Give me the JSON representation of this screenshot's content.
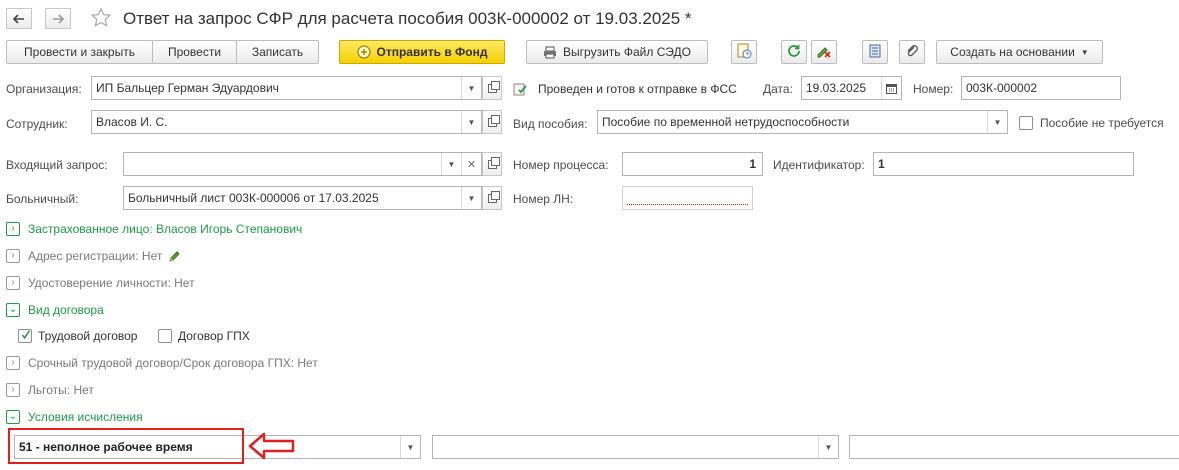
{
  "window": {
    "title": "Ответ на запрос СФР для расчета пособия 003К-000002 от 19.03.2025 *",
    "back_icon": "arrow-left-icon",
    "forward_icon": "arrow-right-icon",
    "favorite_icon": "star-icon"
  },
  "toolbar": {
    "post_close": "Провести и закрыть",
    "post": "Провести",
    "save": "Записать",
    "send_fund": "Отправить в Фонд",
    "export_sedo": "Выгрузить Файл СЭДО",
    "create_based": "Создать на основании"
  },
  "form": {
    "org_label": "Организация:",
    "org_value": "ИП Бальцер Герман Эдуардович",
    "status_text": "Проведен и готов к отправке в ФСС",
    "date_label": "Дата:",
    "date_value": "19.03.2025",
    "number_label": "Номер:",
    "number_value": "003К-000002",
    "employee_label": "Сотрудник:",
    "employee_value": "Власов И. С.",
    "benefit_type_label": "Вид пособия:",
    "benefit_type_value": "Пособие по временной нетрудоспособности",
    "benefit_not_required_label": "Пособие не требуется",
    "incoming_request_label": "Входящий запрос:",
    "incoming_request_value": "",
    "process_number_label": "Номер процесса:",
    "process_number_value": "1",
    "identifier_label": "Идентификатор:",
    "identifier_value": "1",
    "sick_leave_label": "Больничный:",
    "sick_leave_value": "Больничный лист 003К-000006 от 17.03.2025",
    "ln_number_label": "Номер ЛН:",
    "ln_number_value": ""
  },
  "sections": {
    "insured": "Застрахованное лицо: Власов Игорь Степанович",
    "address": "Адрес регистрации: Нет",
    "id_doc": "Удостоверение личности: Нет",
    "contract_type": "Вид договора",
    "labor_contract": "Трудовой договор",
    "gph_contract": "Договор ГПХ",
    "fixed_term": "Срочный трудовой договор/Срок договора ГПХ: Нет",
    "benefits": "Льготы: Нет",
    "calc_conditions": "Условия исчисления"
  },
  "conditions": {
    "condition1_value": "51 - неполное рабочее время",
    "condition2_value": "",
    "condition3_value": ""
  },
  "colors": {
    "accent_green": "#1e9a4a",
    "highlight_red": "#e02020",
    "primary_yellow": "#f5d000"
  }
}
